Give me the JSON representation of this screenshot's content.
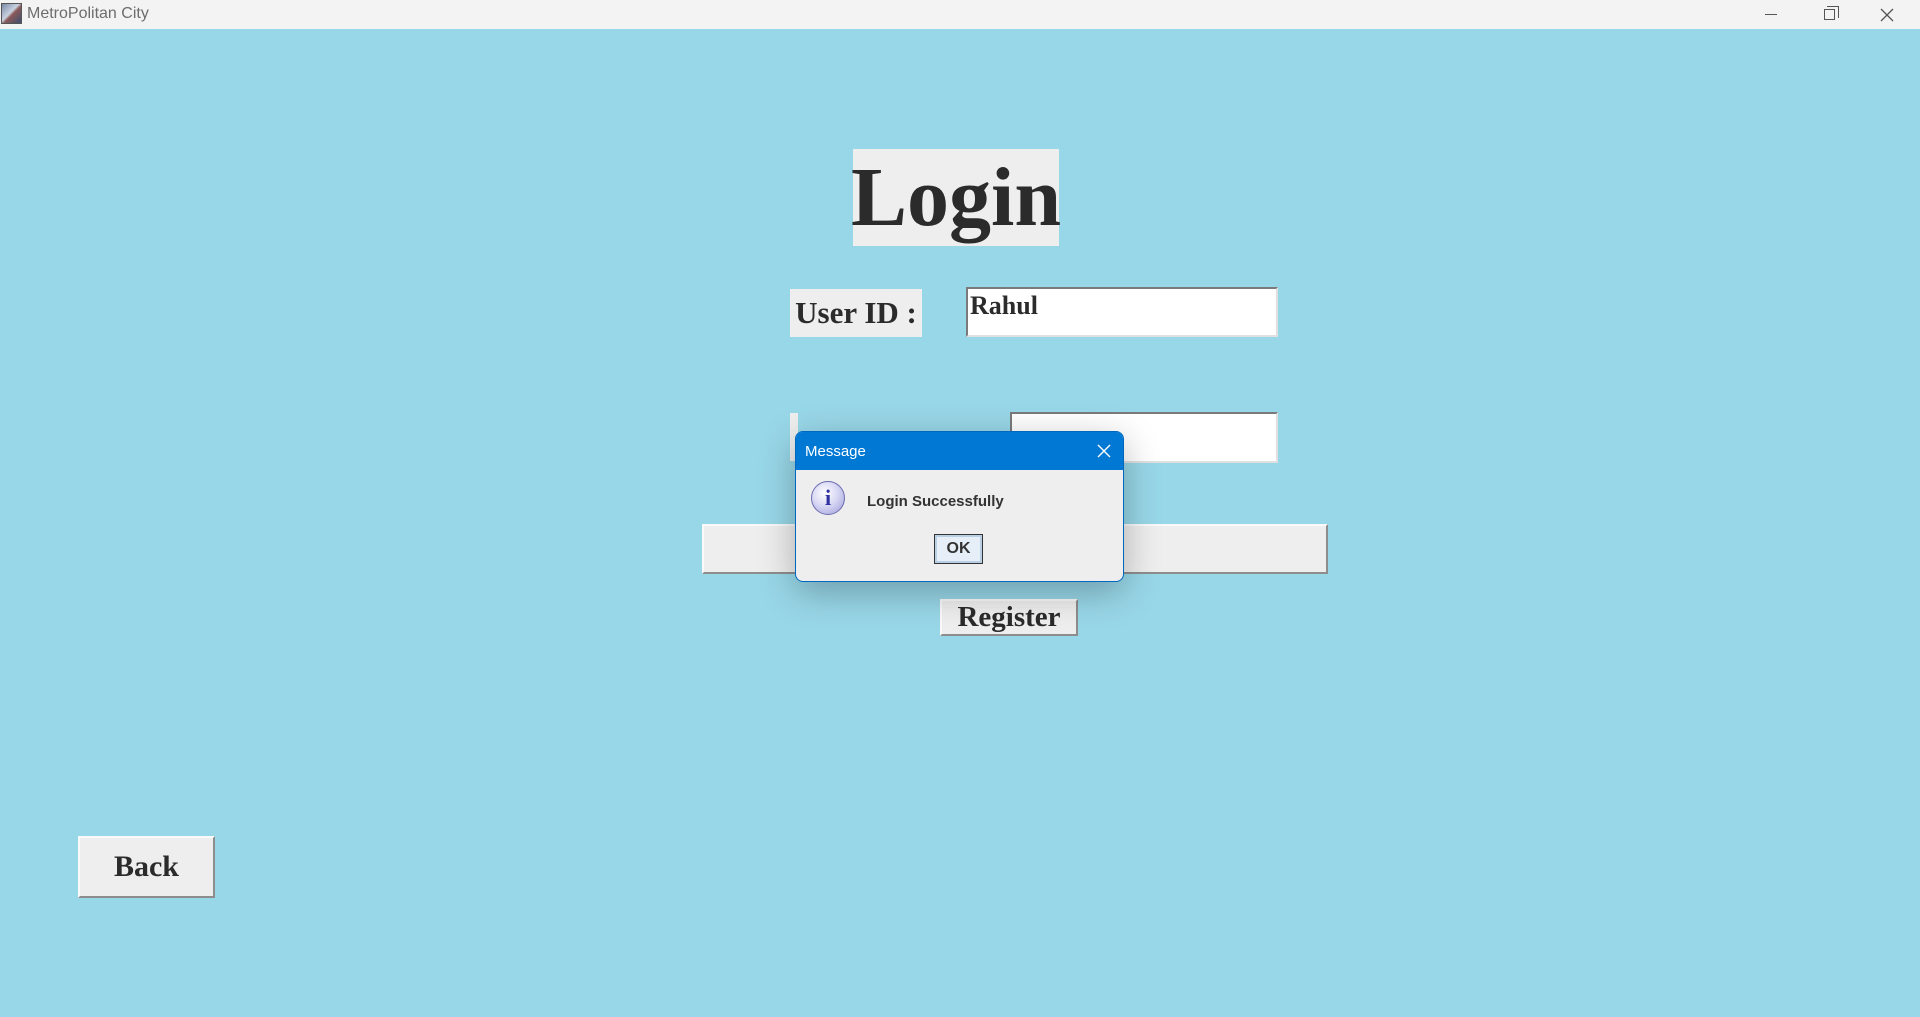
{
  "window": {
    "title": "MetroPolitan City",
    "icon": "app-icon"
  },
  "form": {
    "heading": "Login",
    "userid_label": "User ID :",
    "userid_value": "Rahul",
    "login_label": "Login",
    "register_label": "Register",
    "back_label": "Back"
  },
  "dialog": {
    "title": "Message",
    "message": "Login Successfully",
    "ok_label": "OK",
    "icon": "info-icon"
  },
  "colors": {
    "background": "#98d7e8",
    "dialog_titlebar": "#0078d4"
  }
}
